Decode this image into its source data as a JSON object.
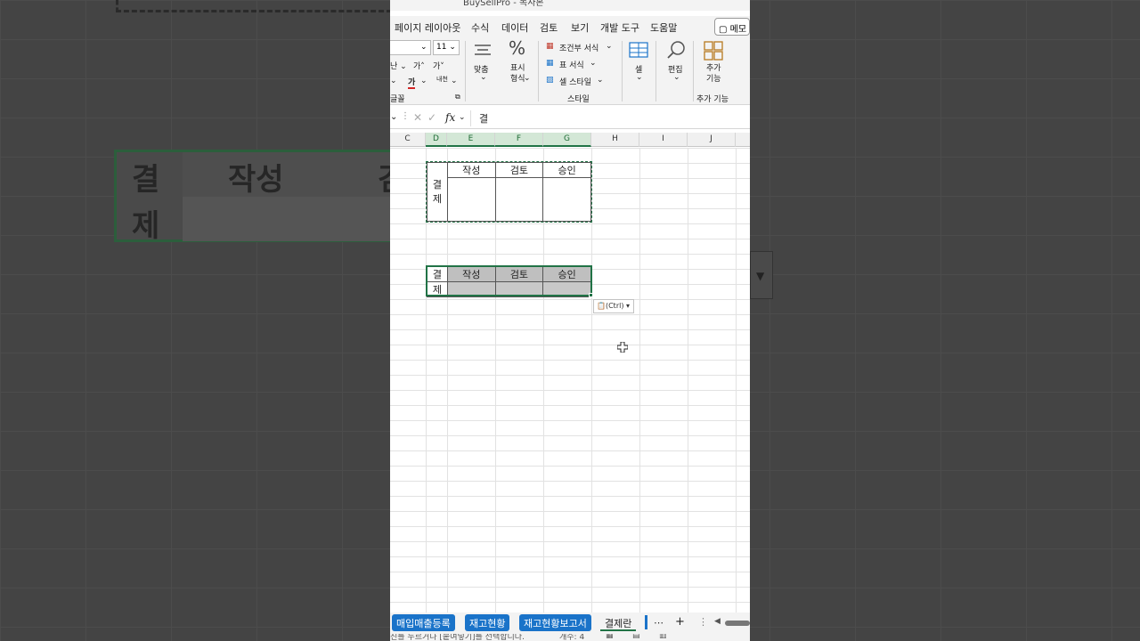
{
  "window": {
    "title": "BuySellPro - 복사본"
  },
  "menu": {
    "tabs": [
      "페이지 레이아웃",
      "수식",
      "데이터",
      "검토",
      "보기",
      "개발 도구",
      "도움말"
    ],
    "memo_label": "메모"
  },
  "ribbon": {
    "font_size": "11",
    "font_group_label": "글꼴",
    "align_label": "맞춤",
    "number_format_label": "표시\n형식",
    "conditional_format": "조건부 서식",
    "table_format": "표 서식",
    "cell_style": "셀 스타일",
    "styles_group_label": "스타일",
    "cells_label": "셀",
    "editing_label": "편집",
    "addins_label": "추가\n기능",
    "addins_group_label": "추가 기능"
  },
  "formula_bar": {
    "fx": "fx",
    "value": "결"
  },
  "columns": [
    "C",
    "D",
    "E",
    "F",
    "G",
    "H",
    "I",
    "J"
  ],
  "selected_columns": [
    "D",
    "E",
    "F",
    "G"
  ],
  "approval_table_1": {
    "side_label": "결\n제",
    "headers": [
      "작성",
      "검토",
      "승인"
    ]
  },
  "approval_table_2": {
    "side_label_top": "결",
    "side_label_bottom": "제",
    "headers": [
      "작성",
      "검토",
      "승인"
    ]
  },
  "paste_options": {
    "label": "(Ctrl)"
  },
  "sheets": [
    {
      "name": "매입매출등록",
      "active": false
    },
    {
      "name": "재고현황",
      "active": false
    },
    {
      "name": "재고현황보고서",
      "active": false
    },
    {
      "name": "결제란",
      "active": true
    }
  ],
  "status": {
    "left_text": "진를 누르거나 [붙여넣기]를 선택합니다.",
    "count_text": "개수: 4"
  },
  "background_zoom": {
    "cells": [
      "결",
      "제",
      "작성",
      "검"
    ]
  },
  "colors": {
    "excel_green": "#217346",
    "sheet_tab_blue": "#1a73c9",
    "header_fill": "#bfbfbf"
  }
}
